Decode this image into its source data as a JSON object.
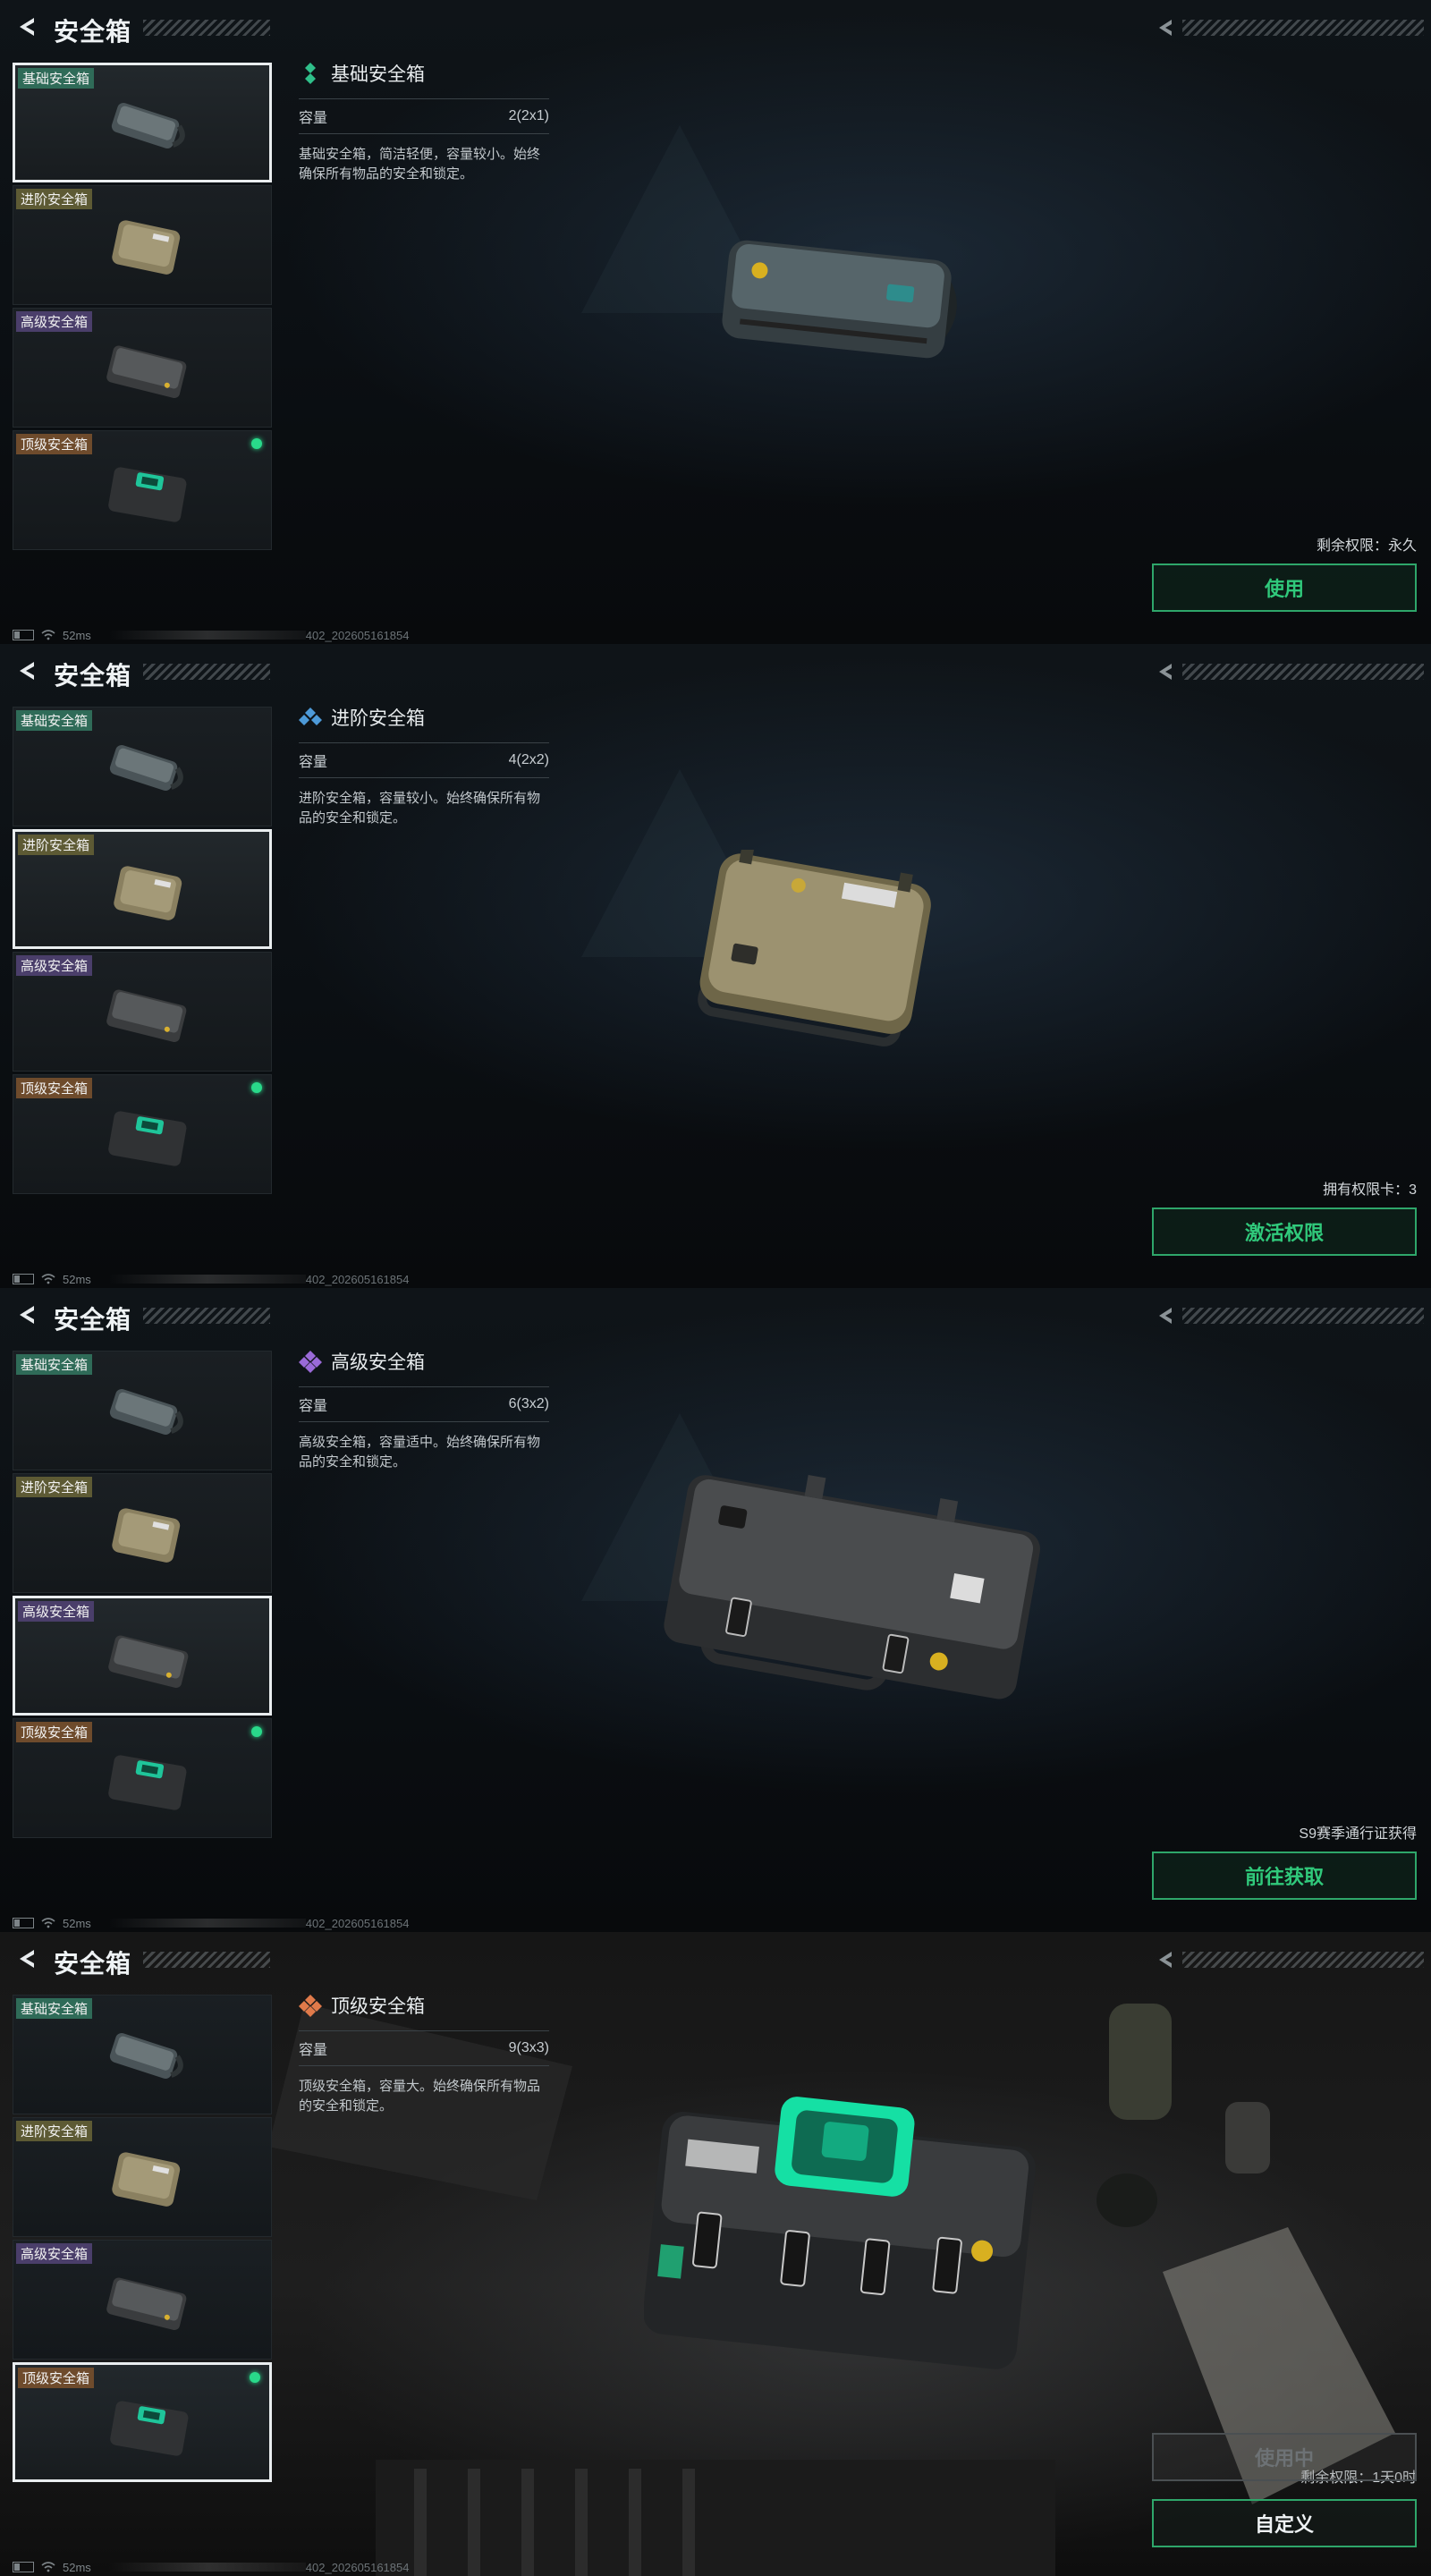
{
  "page": {
    "title": "安全箱"
  },
  "items": [
    {
      "label": "基础安全箱"
    },
    {
      "label": "进阶安全箱"
    },
    {
      "label": "高级安全箱"
    },
    {
      "label": "顶级安全箱"
    }
  ],
  "capacity_label": "容量",
  "status": {
    "ping": "52ms",
    "code": "402_202605161854"
  },
  "panels": [
    {
      "selected": 0,
      "name": "基础安全箱",
      "capacity": "2(2x1)",
      "desc": "基础安全箱，简洁轻便，容量较小。始终确保所有物品的安全和锁定。",
      "note": "剩余权限：永久",
      "button": "使用"
    },
    {
      "selected": 1,
      "name": "进阶安全箱",
      "capacity": "4(2x2)",
      "desc": "进阶安全箱，容量较小。始终确保所有物品的安全和锁定。",
      "note": "拥有权限卡：3",
      "button": "激活权限"
    },
    {
      "selected": 2,
      "name": "高级安全箱",
      "capacity": "6(3x2)",
      "desc": "高级安全箱，容量适中。始终确保所有物品的安全和锁定。",
      "note": "S9赛季通行证获得",
      "button": "前往获取"
    },
    {
      "selected": 3,
      "name": "顶级安全箱",
      "capacity": "9(3x3)",
      "desc": "顶级安全箱，容量大。始终确保所有物品的安全和锁定。",
      "note": "剩余权限：1天0时",
      "button": "使用中",
      "button2": "自定义"
    }
  ],
  "colors": {
    "accent": "#30c97b",
    "dot": "#29d98a"
  }
}
